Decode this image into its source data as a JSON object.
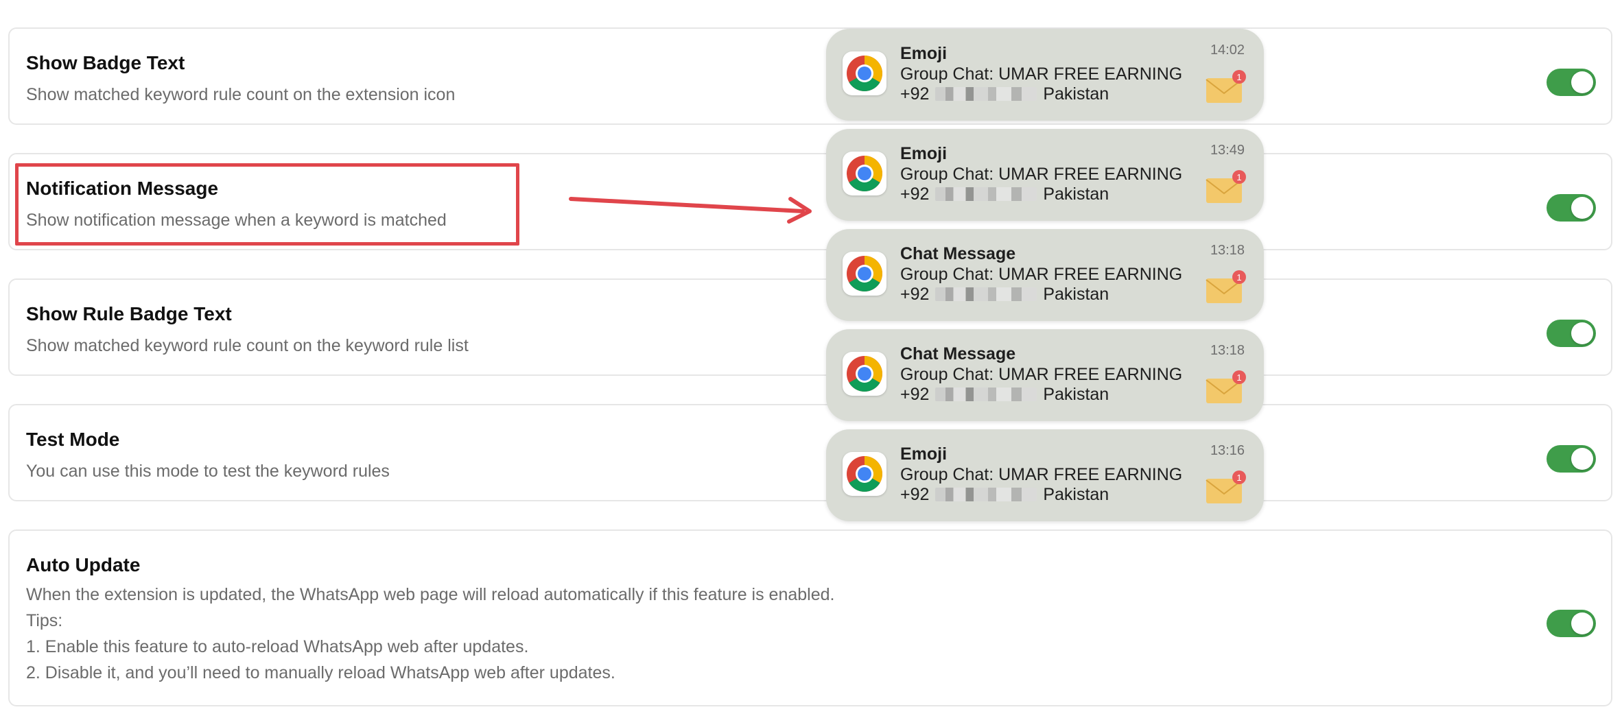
{
  "settings": [
    {
      "title": "Show Badge Text",
      "desc": "Show matched keyword rule count on the extension icon"
    },
    {
      "title": "Notification Message",
      "desc": "Show notification message when a keyword is matched"
    },
    {
      "title": "Show Rule Badge Text",
      "desc": "Show matched keyword rule count on the keyword rule list"
    },
    {
      "title": "Test Mode",
      "desc": "You can use this mode to test the keyword rules"
    },
    {
      "title": "Auto Update",
      "desc_lines": [
        "When the extension is updated, the WhatsApp web page will reload automatically if this feature is enabled.",
        "Tips:",
        "1. Enable this feature to auto-reload WhatsApp web after updates.",
        "2. Disable it, and you’ll need to manually reload WhatsApp web after updates."
      ]
    }
  ],
  "toggles": [
    "on",
    "on",
    "on",
    "on",
    "on"
  ],
  "notifications": [
    {
      "title": "Emoji",
      "line1": "Group Chat: UMAR FREE EARNING",
      "prefix": "+92",
      "suffix": "Pakistan",
      "time": "14:02",
      "badge": "1"
    },
    {
      "title": "Emoji",
      "line1": "Group Chat: UMAR FREE EARNING",
      "prefix": "+92",
      "suffix": "Pakistan",
      "time": "13:49",
      "badge": "1"
    },
    {
      "title": "Chat Message",
      "line1": "Group Chat: UMAR FREE EARNING",
      "prefix": "+92",
      "suffix": "Pakistan",
      "time": "13:18",
      "badge": "1"
    },
    {
      "title": "Chat Message",
      "line1": "Group Chat: UMAR FREE EARNING",
      "prefix": "+92",
      "suffix": "Pakistan",
      "time": "13:18",
      "badge": "1"
    },
    {
      "title": "Emoji",
      "line1": "Group Chat: UMAR FREE EARNING",
      "prefix": "+92",
      "suffix": "Pakistan",
      "time": "13:16",
      "badge": "1"
    }
  ],
  "colors": {
    "toggle_on": "#3f9d4a",
    "highlight": "#e0454b",
    "notification_bg": "#d9dcd5"
  },
  "icons": {
    "notification_app": "chrome-icon",
    "notification_attachment": "mail-envelope-icon",
    "annotation": "arrow-right-icon"
  }
}
